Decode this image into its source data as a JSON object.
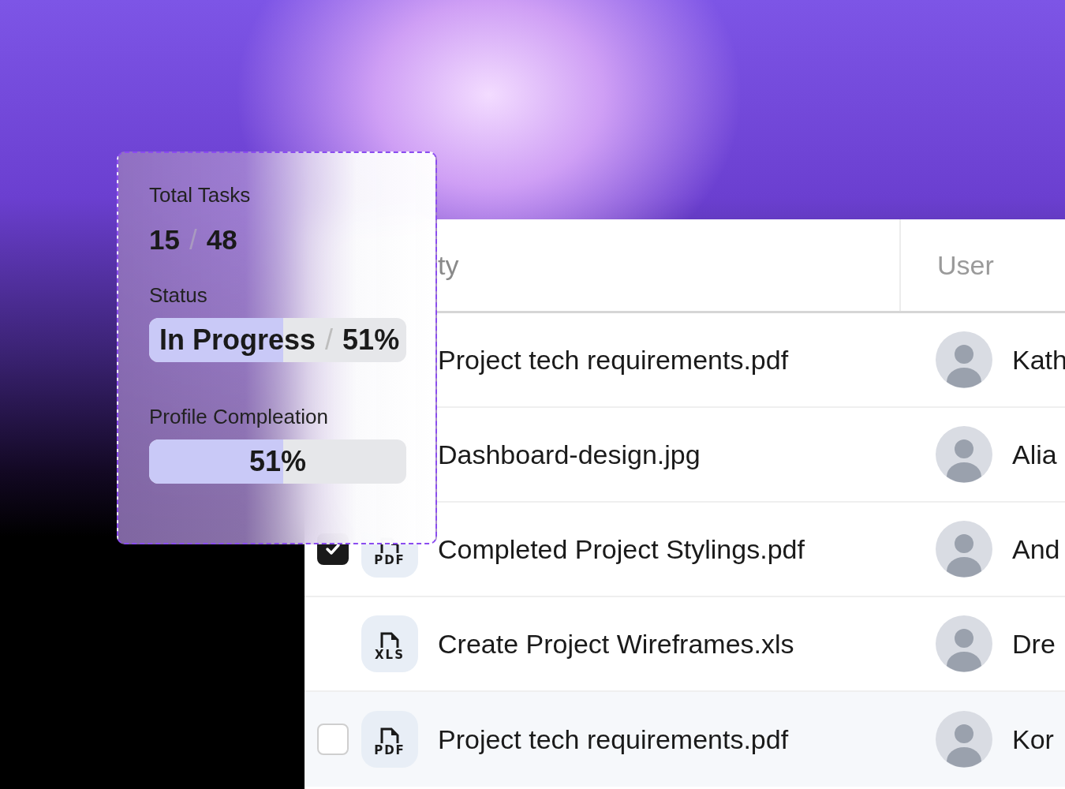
{
  "table": {
    "columns": [
      "ty",
      "User"
    ],
    "rows": [
      {
        "name": "Project tech requirements.pdf",
        "user": "Kath",
        "selected": false
      },
      {
        "name": "Dashboard-design.jpg",
        "user": "Alia",
        "selected": false
      },
      {
        "name": "Completed Project Stylings.pdf",
        "user": "And",
        "file_type": "PDF",
        "checked": true,
        "selected": false
      },
      {
        "name": "Create Project Wireframes.xls",
        "user": "Dre",
        "file_type": "XLS",
        "selected": false
      },
      {
        "name": "Project tech requirements.pdf",
        "user": "Kor",
        "file_type": "PDF",
        "checked": false,
        "selected": true
      }
    ]
  },
  "card": {
    "total_label": "Total Tasks",
    "total_done": "15",
    "separator": "/",
    "total_all": "48",
    "status": {
      "label": "Status",
      "text": "In Progress",
      "separator": "/",
      "value": "51%",
      "level": 0.52
    },
    "profile": {
      "label": "Profile Compleation",
      "value": "51%",
      "level": 0.52
    }
  }
}
